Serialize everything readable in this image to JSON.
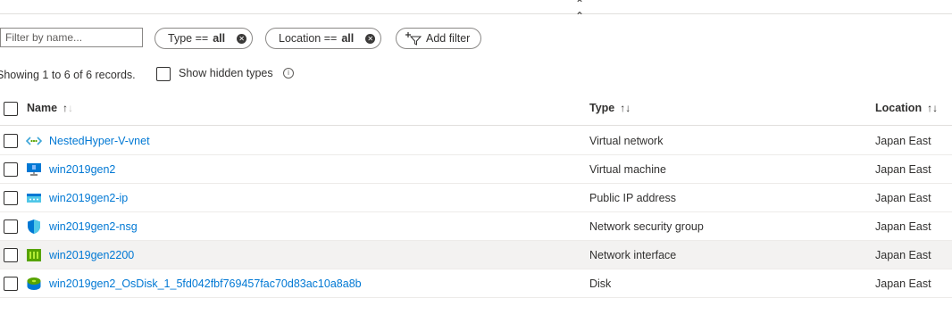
{
  "toolbar": {
    "collapse_icon": "double-chevron-up-icon"
  },
  "filters": {
    "placeholder": "Filter by name...",
    "type_pill": {
      "key": "Type ==",
      "value": "all"
    },
    "location_pill": {
      "key": "Location ==",
      "value": "all"
    },
    "add_filter_label": "Add filter"
  },
  "records_text": "Showing 1 to 6 of 6 records.",
  "show_hidden_label": "Show hidden types",
  "columns": {
    "name": "Name",
    "type": "Type",
    "location": "Location"
  },
  "rows": [
    {
      "name": "NestedHyper-V-vnet",
      "type": "Virtual network",
      "location": "Japan East",
      "icon": "virtual-network-icon"
    },
    {
      "name": "win2019gen2",
      "type": "Virtual machine",
      "location": "Japan East",
      "icon": "virtual-machine-icon"
    },
    {
      "name": "win2019gen2-ip",
      "type": "Public IP address",
      "location": "Japan East",
      "icon": "public-ip-icon"
    },
    {
      "name": "win2019gen2-nsg",
      "type": "Network security group",
      "location": "Japan East",
      "icon": "shield-icon"
    },
    {
      "name": "win2019gen2200",
      "type": "Network interface",
      "location": "Japan East",
      "icon": "network-interface-icon"
    },
    {
      "name": "win2019gen2_OsDisk_1_5fd042fbf769457fac70d83ac10a8a8b",
      "type": "Disk",
      "location": "Japan East",
      "icon": "disk-icon"
    }
  ],
  "colors": {
    "link": "#0078d4",
    "hover_row": "#f3f2f1"
  }
}
